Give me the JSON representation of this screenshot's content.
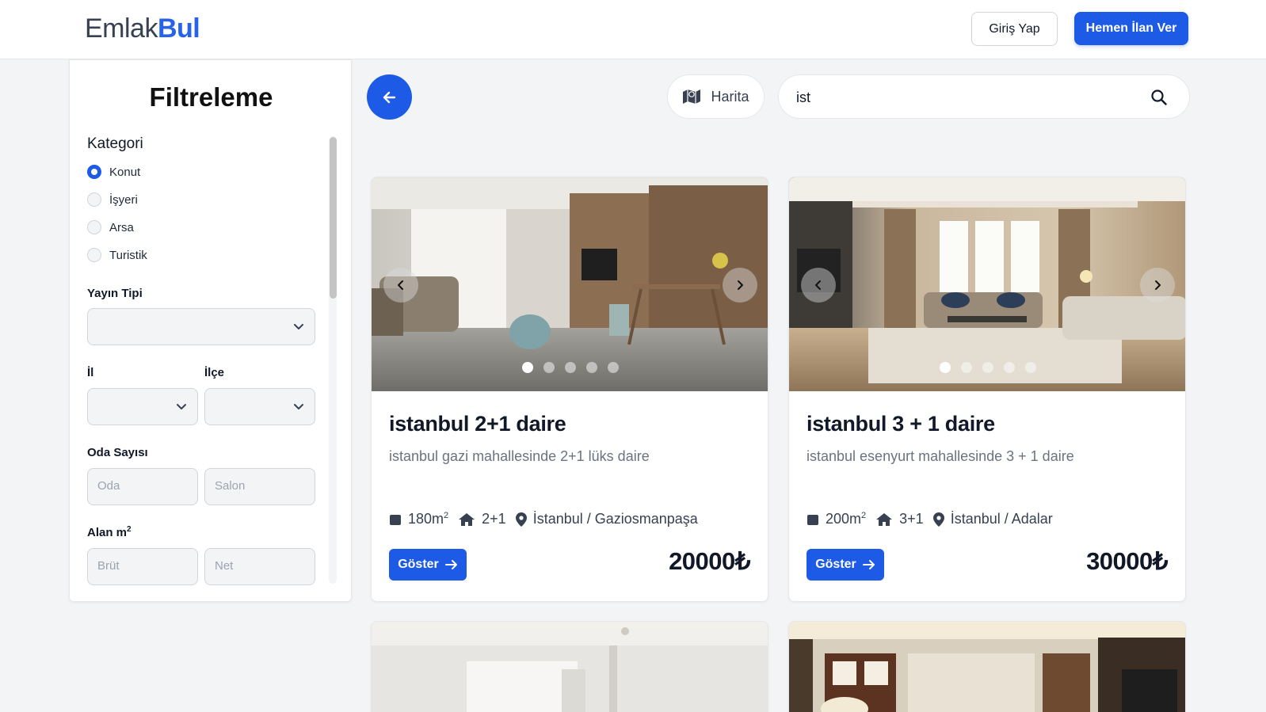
{
  "header": {
    "logo_part1": "Emlak",
    "logo_part2": "Bul",
    "login_label": "Giriş Yap",
    "post_label": "Hemen İlan Ver"
  },
  "sidebar": {
    "title": "Filtreleme",
    "category": {
      "label": "Kategori",
      "options": [
        "Konut",
        "İşyeri",
        "Arsa",
        "Turistik"
      ],
      "selected": "Konut"
    },
    "listing_type_label": "Yayın Tipi",
    "city_label": "İl",
    "district_label": "İlçe",
    "rooms_label": "Oda Sayısı",
    "room_placeholder": "Oda",
    "salon_placeholder": "Salon",
    "area_label": "Alan m",
    "area_sup": "2",
    "gross_placeholder": "Brüt",
    "net_placeholder": "Net"
  },
  "toolbar": {
    "back_icon": "arrow-left-icon",
    "map_label": "Harita",
    "search_value": "ist",
    "search_icon": "search-icon"
  },
  "listings": [
    {
      "title": "istanbul 2+1 daire",
      "description": "istanbul gazi mahallesinde 2+1 lüks daire",
      "area": "180m",
      "area_sup": "2",
      "rooms": "2+1",
      "location": "İstanbul / Gaziosmanpaşa",
      "button": "Göster",
      "price": "20000₺"
    },
    {
      "title": "istanbul 3 + 1 daire",
      "description": "istanbul esenyurt mahallesinde 3 + 1 daire",
      "area": "200m",
      "area_sup": "2",
      "rooms": "3+1",
      "location": "İstanbul / Adalar",
      "button": "Göster",
      "price": "30000₺"
    }
  ],
  "colors": {
    "primary": "#1d5ae6",
    "background": "#f3f4f6"
  }
}
